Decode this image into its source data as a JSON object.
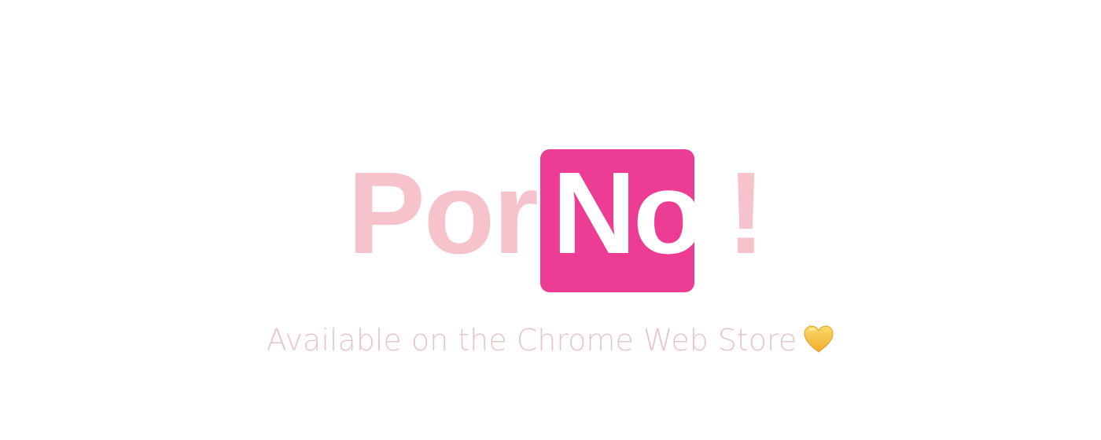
{
  "logo": {
    "part_1": "Por",
    "part_2": "No",
    "part_3": "!"
  },
  "tagline": "Available on the Chrome Web Store",
  "icons": {
    "heart": "yellow-heart-icon"
  },
  "colors": {
    "light_pink": "#f6c3cc",
    "hot_pink": "#ec3c94",
    "tagline": "#e8c6c6",
    "heart": "#f7c84a"
  }
}
